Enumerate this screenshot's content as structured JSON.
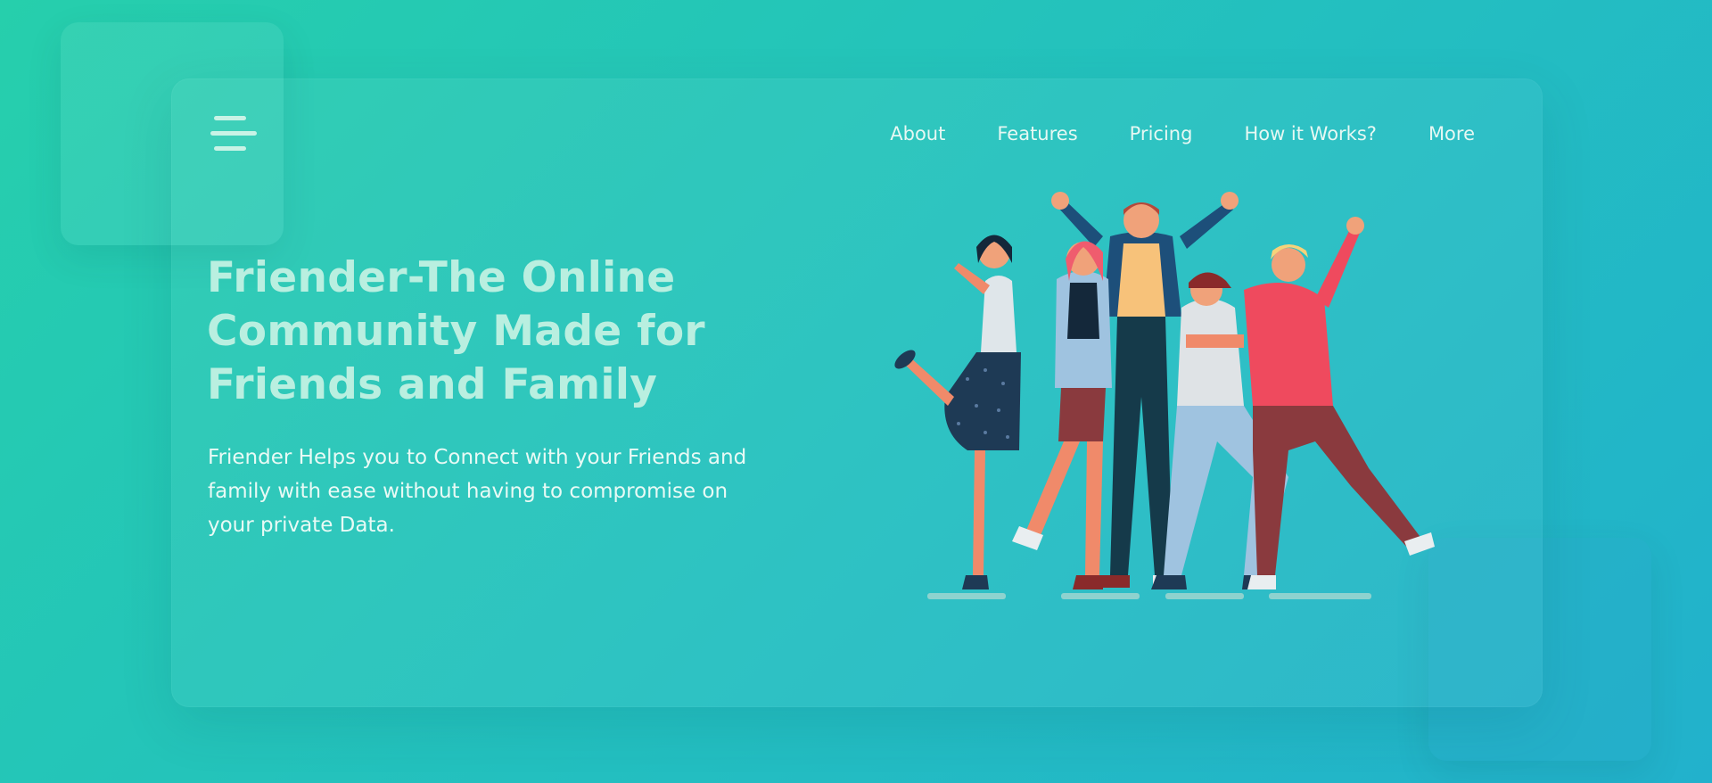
{
  "menu": {
    "icon": "hamburger-icon"
  },
  "nav": {
    "items": [
      {
        "label": "About"
      },
      {
        "label": "Features"
      },
      {
        "label": "Pricing"
      },
      {
        "label": "How it Works?"
      },
      {
        "label": "More"
      }
    ]
  },
  "hero": {
    "title": "Friender-The Online Community Made for Friends and Family",
    "subtitle": "Friender Helps you to Connect with your Friends and family with ease without having to compromise on your private Data."
  },
  "illustration": {
    "icon": "group-of-friends-illustration"
  },
  "colors": {
    "background_start": "#26cfac",
    "background_end": "#22b1cc",
    "title": "#b9efe0",
    "text": "#e8faf5"
  }
}
